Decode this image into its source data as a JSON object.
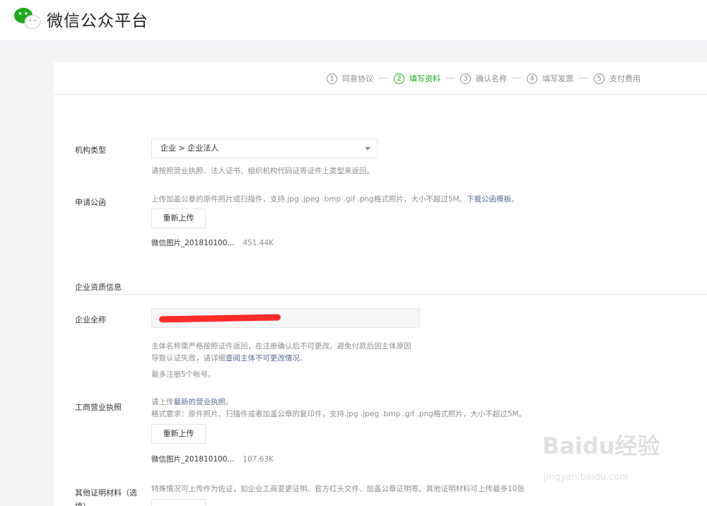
{
  "header": {
    "brand": "微信公众平台",
    "logo_icon": "wechat-logo-icon"
  },
  "steps": [
    {
      "num": "1",
      "label": "同意协议",
      "active": false
    },
    {
      "num": "2",
      "label": "填写资料",
      "active": true
    },
    {
      "num": "3",
      "label": "确认名称",
      "active": false
    },
    {
      "num": "4",
      "label": "填写发票",
      "active": false
    },
    {
      "num": "5",
      "label": "支付费用",
      "active": false
    }
  ],
  "org_type": {
    "label": "机构类型",
    "selected": "企业 > 企业法人",
    "hint": "请按照营业执照、法人证书、组织机构代码证等证件上类型来返回。"
  },
  "application_letter": {
    "label": "申请公函",
    "hint": "上传加盖公章的原件照片或扫描件，支持.jpg .jpeg .bmp .gif .png格式照片，大小不超过5M。",
    "link": "下载公函模板",
    "link_suffix": "。",
    "button": "重新上传",
    "file_name": "微信图片_201810100...",
    "file_size": "451.44K"
  },
  "section_title": "企业资质信息",
  "company_name": {
    "label": "企业全称",
    "hint_line1": "主体名称需严格按照证件返回，在注册确认后不可更改。避免付款后因主体原因",
    "hint_line2_prefix": "导致认证失败，请详细",
    "hint_line2_link": "查阅主体不可更改情况",
    "hint_line2_suffix": "。",
    "hint_line3": "最多注册5个帐号。"
  },
  "business_license": {
    "label": "工商营业执照",
    "hint1_prefix": "请上传",
    "hint1_link": "最新的营业执照",
    "hint1_suffix": "。",
    "hint2": "格式要求：原件照片、扫描件或者加盖公章的复印件，支持.jpg .jpeg .bmp .gif .png格式照片，大小不超过5M。",
    "button": "重新上传",
    "file_name": "微信图片_201810100...",
    "file_size": "107.63K"
  },
  "other_docs": {
    "label_line1": "其他证明材料（选",
    "label_line2": "填）",
    "hint": "特殊情况可上传作为佐证，如企业工商变更证明、官方红头文件、加盖公章证明等。其他证明材料可上传最多10张"
  },
  "watermark": {
    "main": "Bai",
    "paw": "du",
    "cn": "经验",
    "sub": "jingyan.baidu.com"
  },
  "colors": {
    "active_green": "#1aad19",
    "link_blue": "#576b95",
    "redaction": "#ff2a2a"
  }
}
